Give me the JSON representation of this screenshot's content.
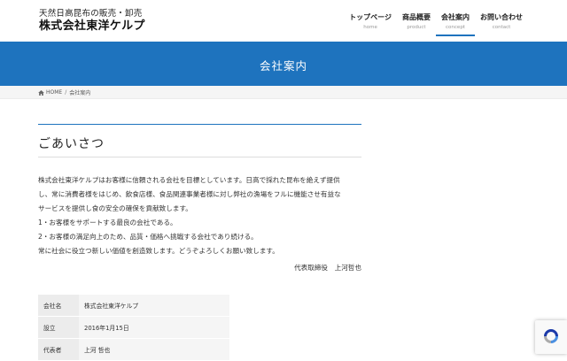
{
  "header": {
    "tagline": "天然日高昆布の販売・卸売",
    "company": "株式会社東洋ケルプ",
    "nav": [
      {
        "ja": "トップページ",
        "en": "home"
      },
      {
        "ja": "商品概要",
        "en": "product"
      },
      {
        "ja": "会社案内",
        "en": "concept"
      },
      {
        "ja": "お問い合わせ",
        "en": "contact"
      }
    ]
  },
  "banner": {
    "title": "会社案内"
  },
  "breadcrumb": {
    "home": "HOME",
    "separator": "/",
    "current": "会社案内"
  },
  "greeting": {
    "title": "ごあいさつ",
    "lines": [
      "株式会社東洋ケルプはお客様に信頼される会社を目標としています。日高で採れた昆布を絶えず提供",
      "し、常に消費者様をはじめ、飲食店様、食品関連事業者様に対し弊社の漁場をフルに機能させ有益な",
      "サービスを提供し食の安全の確保を貢献致します。",
      "1・お客様をサポートする最良の会社である。",
      "2・お客様の満足向上のため、品質・価格へ挑戦する会社であり続ける。",
      "常に社会に役立つ新しい価値を創造致します。どうぞよろしくお願い致します。"
    ],
    "signature": "代表取締役　上河哲也"
  },
  "company_table": [
    {
      "label": "会社名",
      "value": "株式会社東洋ケルプ"
    },
    {
      "label": "設立",
      "value": "2016年1月15日"
    },
    {
      "label": "代表者",
      "value": "上河 哲也"
    }
  ],
  "colors": {
    "primary": "#1e73be",
    "breadcrumb_bg": "#f5f5f5",
    "table_label_bg": "#ececec"
  }
}
